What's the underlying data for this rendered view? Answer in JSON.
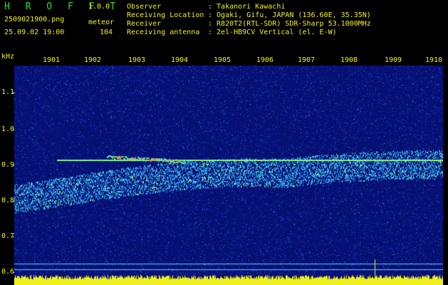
{
  "header": {
    "app_name": "H R O F F T",
    "version": "1.0.0",
    "filename": "2509021900.png",
    "mode": "meteor",
    "datetime": "25.09.02 19:00",
    "count": "104",
    "fields": [
      {
        "label": "Observer",
        "value": ": Takanori Kawachi"
      },
      {
        "label": "Receiving Location",
        "value": ": Ogaki, Gifu, JAPAN (136.60E, 35.35N)"
      },
      {
        "label": "Receiver",
        "value": ": R820T2(RTL-SDR) SDR-Sharp 53.1000MHz"
      },
      {
        "label": "Receiving antenna",
        "value": ": 2el-HB9CV Vertical (el. E-W)"
      }
    ]
  },
  "axes": {
    "y_unit": "kHz",
    "x_ticks": [
      "1901",
      "1902",
      "1903",
      "1904",
      "1905",
      "1906",
      "1907",
      "1908",
      "1909",
      "1910"
    ],
    "y_ticks": [
      "1.1",
      "1.0",
      "0.9",
      "0.8",
      "0.7",
      "0.6"
    ]
  },
  "colors": {
    "background": "#000000",
    "noise": "#0a1a8c",
    "accent_green": "#22e022",
    "accent_yellow": "#f0f020"
  }
}
